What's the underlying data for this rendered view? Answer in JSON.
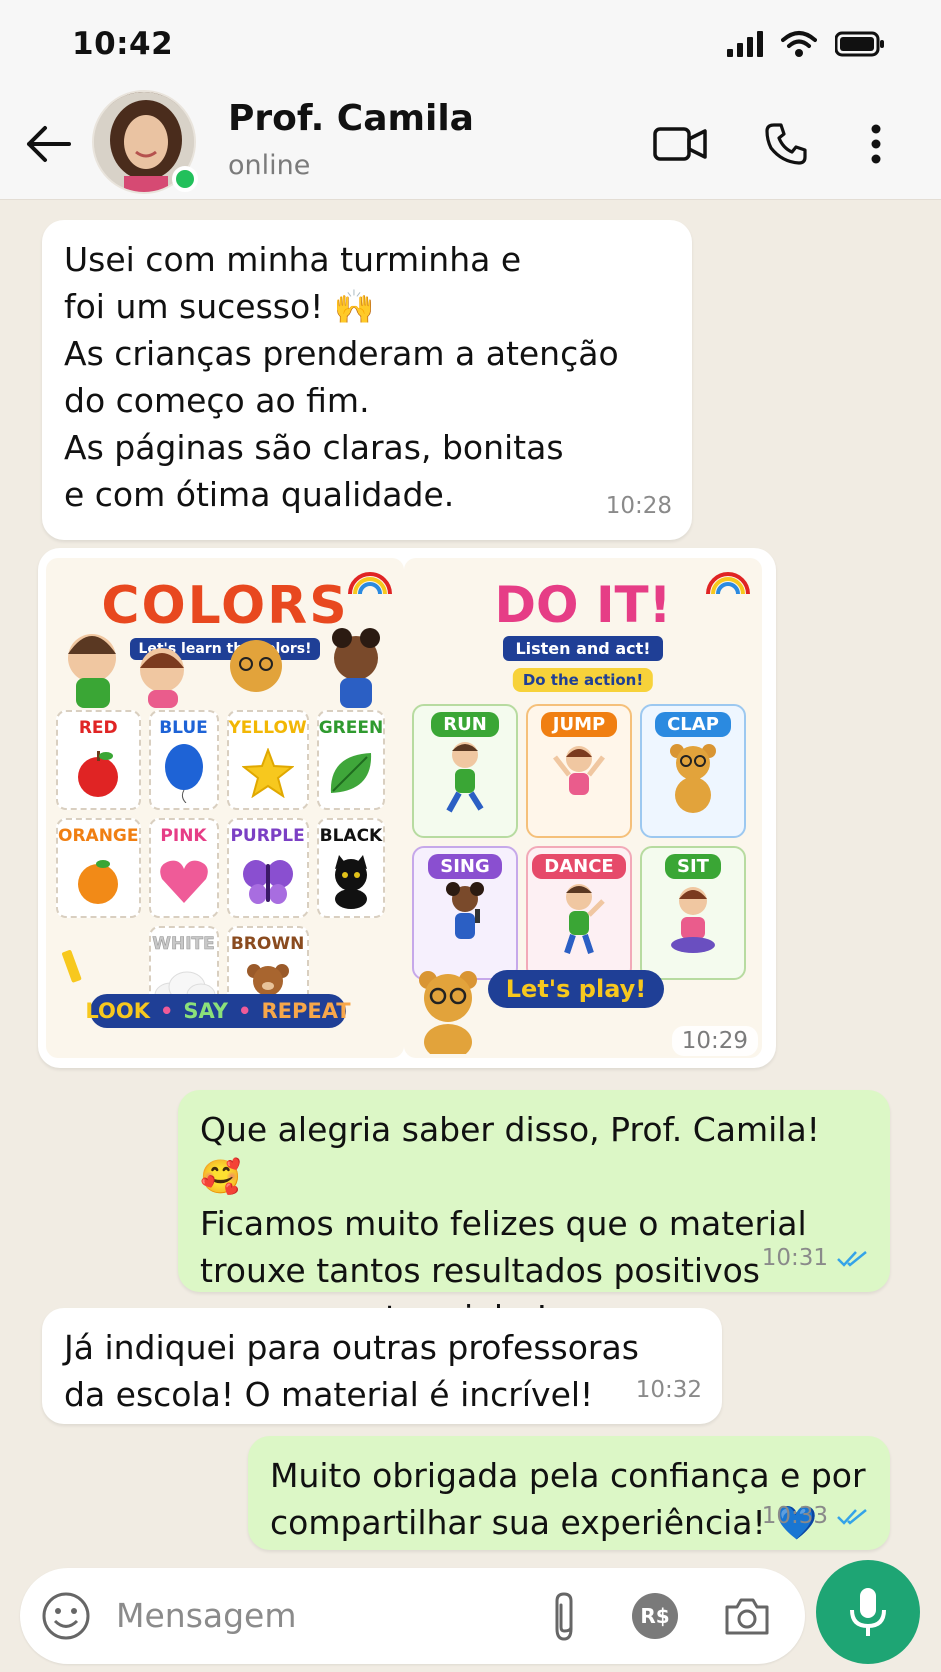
{
  "status_bar": {
    "time": "10:42"
  },
  "header": {
    "contact_name": "Prof. Camila",
    "contact_status": "online"
  },
  "messages": [
    {
      "direction": "incoming",
      "text": "Usei com minha turminha e\nfoi um sucesso! 🙌\nAs crianças prenderam a atenção\ndo começo ao fim.\nAs páginas são claras, bonitas\ne com ótima qualidade.",
      "time": "10:28"
    },
    {
      "direction": "incoming",
      "type": "images",
      "time": "10:29"
    },
    {
      "direction": "outgoing",
      "text": "Que alegria saber disso, Prof. Camila! 🥰\nFicamos muito felizes que o material\ntrouxe tantos resultados positivos\npara a sua turminha!",
      "time": "10:31",
      "status": "read"
    },
    {
      "direction": "incoming",
      "text": "Já indiquei para outras professoras\nda escola! O material é incrível!",
      "time": "10:32"
    },
    {
      "direction": "outgoing",
      "text": "Muito obrigada pela confiança e por\ncompartilhar sua experiência! 💙",
      "time": "10:33",
      "status": "read"
    }
  ],
  "poster_colors": {
    "title": "COLORS",
    "subtitle": "Let's learn the colors!",
    "cards": [
      {
        "label": "RED",
        "color": "#e02424",
        "icon": "apple-icon"
      },
      {
        "label": "BLUE",
        "color": "#1e63d6",
        "icon": "balloon-icon"
      },
      {
        "label": "YELLOW",
        "color": "#f2b705",
        "icon": "star-icon"
      },
      {
        "label": "GREEN",
        "color": "#2f9a2f",
        "icon": "leaf-icon"
      },
      {
        "label": "ORANGE",
        "color": "#f07f12",
        "icon": "orange-icon"
      },
      {
        "label": "PINK",
        "color": "#e63d86",
        "icon": "heart-icon"
      },
      {
        "label": "PURPLE",
        "color": "#7b3fc4",
        "icon": "butterfly-icon"
      },
      {
        "label": "BLACK",
        "color": "#111111",
        "icon": "cat-icon"
      },
      {
        "label": "WHITE",
        "color": "#bdbdbd",
        "icon": "cloud-icon"
      },
      {
        "label": "BROWN",
        "color": "#8a4b1f",
        "icon": "teddy-bear-icon"
      }
    ],
    "footer_words": [
      "LOOK",
      "SAY",
      "REPEAT"
    ]
  },
  "poster_actions": {
    "title": "DO IT!",
    "subtitle": "Listen and act!",
    "instruction": "Do the action!",
    "cards": [
      {
        "label": "RUN",
        "color": "#3aa635"
      },
      {
        "label": "JUMP",
        "color": "#f07f12"
      },
      {
        "label": "CLAP",
        "color": "#2b8ae0"
      },
      {
        "label": "SING",
        "color": "#8a4fd0"
      },
      {
        "label": "DANCE",
        "color": "#e64a6a"
      },
      {
        "label": "SIT",
        "color": "#3aa635"
      }
    ],
    "footer": "Let's play!"
  },
  "composer": {
    "placeholder": "Mensagem",
    "pix_label": "R$"
  },
  "colors": {
    "accent_green": "#1ea574",
    "outgoing_bubble": "#dcf7c6",
    "read_ticks": "#34a3e8"
  }
}
